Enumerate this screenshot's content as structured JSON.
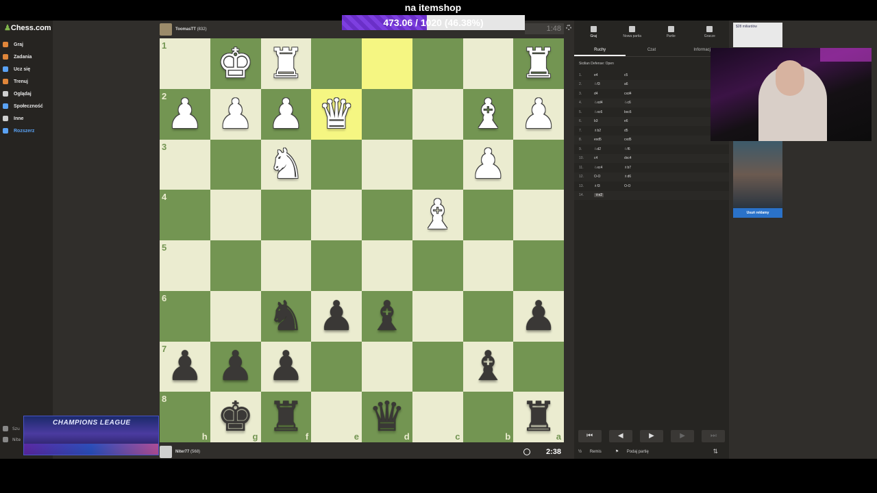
{
  "stream": {
    "itemshop_label": "na itemshop",
    "goal_text": "473.06 / 1020 (46.38%)",
    "goal_fraction": 0.4638
  },
  "sidebar": {
    "logo": "Chess.com",
    "items": [
      {
        "label": "Graj",
        "color": "#e0863a"
      },
      {
        "label": "Zadania",
        "color": "#e0863a"
      },
      {
        "label": "Ucz się",
        "color": "#5aa2f4"
      },
      {
        "label": "Trenuj",
        "color": "#e0863a"
      },
      {
        "label": "Oglądaj",
        "color": "#cfcfcf"
      },
      {
        "label": "Społeczność",
        "color": "#5aa2f4"
      },
      {
        "label": "Inne",
        "color": "#cfcfcf"
      },
      {
        "label": "Rozszerz",
        "color": "#5aa2f4"
      }
    ],
    "bottom": [
      "Szu",
      "Nite"
    ],
    "overlay_title": "CHAMPIONS LEAGUE"
  },
  "game": {
    "top_player": {
      "name": "ToomasTT",
      "rating": "(832)",
      "clock": "1:48"
    },
    "bottom_player": {
      "name": "Niter77",
      "rating": "(568)",
      "clock": "2:38"
    },
    "board": [
      [
        "",
        "wK",
        "wR",
        "",
        "",
        "",
        "",
        "wR"
      ],
      [
        "wP",
        "wP",
        "wP",
        "wQ",
        "",
        "",
        "wB",
        "wP"
      ],
      [
        "",
        "",
        "wN",
        "",
        "",
        "",
        "wP",
        ""
      ],
      [
        "",
        "",
        "",
        "",
        "",
        "wB",
        "",
        ""
      ],
      [
        "",
        "",
        "",
        "",
        "",
        "",
        "",
        ""
      ],
      [
        "",
        "",
        "bN",
        "bP",
        "bB",
        "",
        "",
        "bP"
      ],
      [
        "bP",
        "bP",
        "bP",
        "",
        "",
        "",
        "bB",
        ""
      ],
      [
        "",
        "bK",
        "bR",
        "",
        "bQ",
        "",
        "",
        "bR"
      ]
    ],
    "ranks": [
      "1",
      "2",
      "3",
      "4",
      "5",
      "6",
      "7",
      "8"
    ],
    "files": [
      "h",
      "g",
      "f",
      "e",
      "d",
      "c",
      "b",
      "a"
    ],
    "highlight": [
      [
        0,
        4
      ],
      [
        1,
        3
      ]
    ]
  },
  "panel": {
    "tabs": [
      "Graj",
      "Nowa partia",
      "Partie",
      "Gracze"
    ],
    "subtabs": [
      "Ruchy",
      "Czat",
      "Informacje"
    ],
    "opening": "Sicilian Defense: Open",
    "moves": [
      {
        "n": "1.",
        "w": "e4",
        "b": "c5"
      },
      {
        "n": "2.",
        "w": "♘f3",
        "b": "a6"
      },
      {
        "n": "3.",
        "w": "d4",
        "b": "cxd4"
      },
      {
        "n": "4.",
        "w": "♘xd4",
        "b": "♘c6"
      },
      {
        "n": "5.",
        "w": "♘xc6",
        "b": "bxc6"
      },
      {
        "n": "6.",
        "w": "b3",
        "b": "e6"
      },
      {
        "n": "7.",
        "w": "♗b2",
        "b": "d5"
      },
      {
        "n": "8.",
        "w": "exd5",
        "b": "cxd5"
      },
      {
        "n": "9.",
        "w": "♘d2",
        "b": "♘f6"
      },
      {
        "n": "10.",
        "w": "c4",
        "b": "dxc4"
      },
      {
        "n": "11.",
        "w": "♘xc4",
        "b": "♗b7"
      },
      {
        "n": "12.",
        "w": "O-O",
        "b": "♗d6"
      },
      {
        "n": "13.",
        "w": "♗f3",
        "b": "O-O"
      },
      {
        "n": "14.",
        "w": "♕e2",
        "b": ""
      }
    ],
    "controls": [
      "⏮",
      "◀",
      "▶",
      "▶",
      "⏭"
    ],
    "draw_label": "Remis",
    "resign_label": "Podaj partię",
    "draw_icon": "½",
    "resign_icon": "⚑",
    "flip_icon": "⇅"
  },
  "ads": {
    "top_text": "$28 miliardów",
    "remove_label": "Usuń reklamy"
  }
}
